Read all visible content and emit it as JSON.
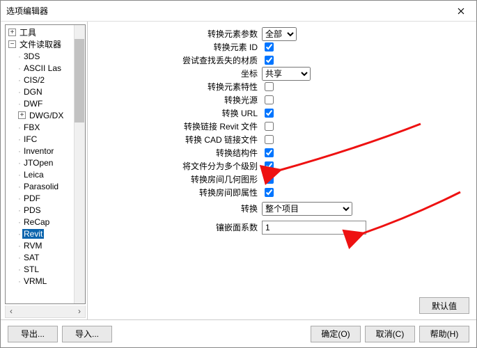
{
  "window": {
    "title": "选项编辑器"
  },
  "tree": {
    "root1": {
      "label": "工具",
      "expand": "+"
    },
    "root2": {
      "label": "文件读取器",
      "expand": "−"
    },
    "children": {
      "n0": "3DS",
      "n1": "ASCII Las",
      "n2": "CIS/2",
      "n3": "DGN",
      "n4": "DWF",
      "n5": {
        "label": "DWG/DX",
        "expand": "+"
      },
      "n6": "FBX",
      "n7": "IFC",
      "n8": "Inventor",
      "n9": "JTOpen",
      "n10": "Leica",
      "n11": "Parasolid",
      "n12": "PDF",
      "n13": "PDS",
      "n14": "ReCap",
      "n15": "Revit",
      "n16": "RVM",
      "n17": "SAT",
      "n18": "STL",
      "n19": "VRML"
    }
  },
  "form": {
    "r0": {
      "label": "转换元素参数",
      "sel": "全部"
    },
    "r1": {
      "label": "转换元素 ID",
      "checked": true
    },
    "r2": {
      "label": "尝试查找丢失的材质",
      "checked": true
    },
    "r3": {
      "label": "坐标",
      "sel": "共享"
    },
    "r4": {
      "label": "转换元素特性",
      "checked": false
    },
    "r5": {
      "label": "转换光源",
      "checked": false
    },
    "r6": {
      "label": "转换 URL",
      "checked": true
    },
    "r7": {
      "label": "转换链接 Revit 文件",
      "checked": false
    },
    "r8": {
      "label": "转换 CAD 链接文件",
      "checked": false
    },
    "r9": {
      "label": "转换结构件",
      "checked": true
    },
    "r10": {
      "label": "将文件分为多个级别",
      "checked": true
    },
    "r11": {
      "label": "转换房间几何图形",
      "checked": true
    },
    "r12": {
      "label": "转换房间即属性",
      "checked": true
    },
    "r13": {
      "label": "转换",
      "sel": "整个项目"
    },
    "r14": {
      "label": "镶嵌面系数",
      "val": "1"
    }
  },
  "buttons": {
    "defaults": "默认值",
    "export": "导出...",
    "import": "导入...",
    "ok": "确定(O)",
    "cancel": "取消(C)",
    "help": "帮助(H)"
  }
}
